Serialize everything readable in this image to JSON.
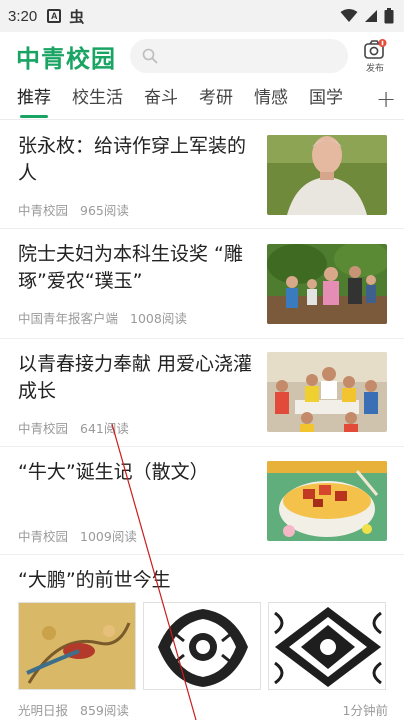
{
  "status_bar": {
    "time": "3:20",
    "left_icons": [
      "a-box-icon",
      "bug-icon"
    ],
    "right_icons": [
      "wifi-icon",
      "signal-icon",
      "battery-icon"
    ]
  },
  "header": {
    "logo": "中青校园",
    "search_placeholder": "",
    "publish_label": "发布",
    "brand_color": "#19a463"
  },
  "tabs": {
    "items": [
      {
        "label": "推荐",
        "active": true
      },
      {
        "label": "校生活"
      },
      {
        "label": "奋斗"
      },
      {
        "label": "考研"
      },
      {
        "label": "情感"
      },
      {
        "label": "国学"
      }
    ],
    "add_icon": "plus-icon"
  },
  "articles": [
    {
      "title": "张永枚：给诗作穿上军装的人",
      "source": "中青校园",
      "reads": "965阅读",
      "thumb": "elderly-man-photo"
    },
    {
      "title": "院士夫妇为本科生设奖 “雕琢”爱农“璞玉”",
      "source": "中国青年报客户端",
      "reads": "1008阅读",
      "thumb": "family-garden-photo"
    },
    {
      "title": "以青春接力奉献 用爱心浇灌成长",
      "source": "中青校园",
      "reads": "641阅读",
      "thumb": "children-classroom-photo"
    },
    {
      "title": "“牛大”诞生记（散文）",
      "source": "中青校园",
      "reads": "1009阅读",
      "thumb": "noodle-bowl-illustration"
    },
    {
      "title": "“大鹏”的前世今生",
      "source": "光明日报",
      "reads": "859阅读",
      "time_ago": "1分钟前",
      "images": [
        "phoenix-painting",
        "bird-papercut-1",
        "bird-papercut-2"
      ]
    }
  ]
}
